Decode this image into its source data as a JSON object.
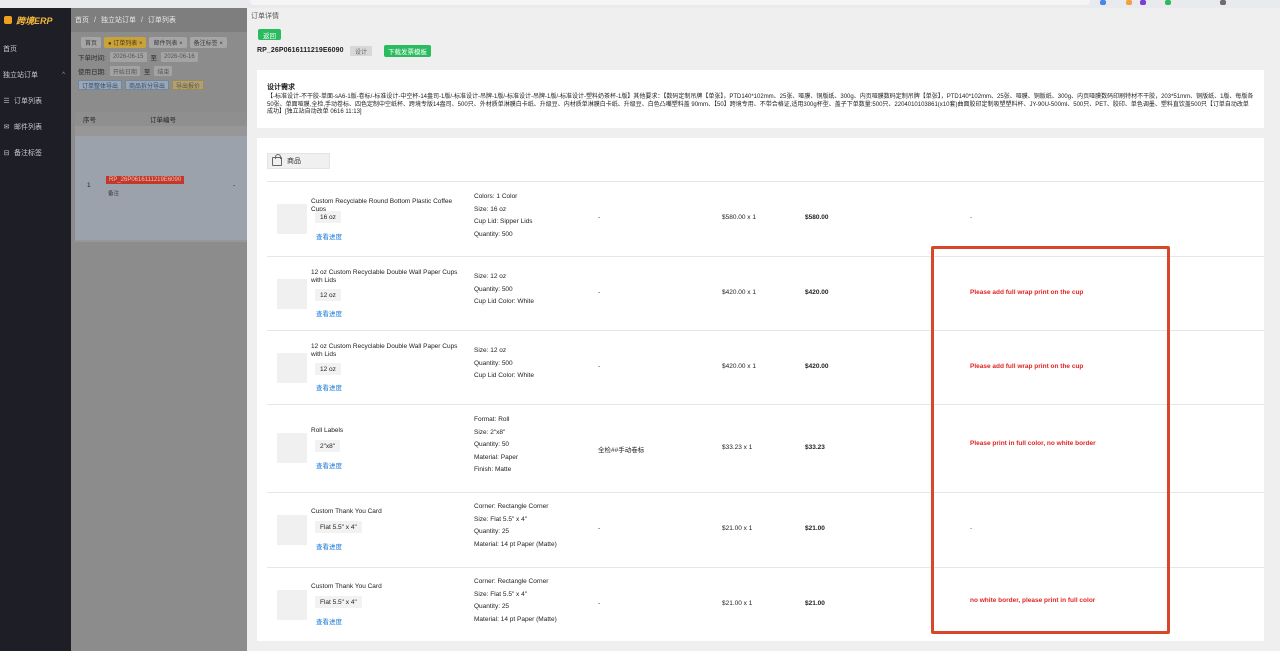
{
  "sidebar": {
    "logo": "跨境ERP",
    "items": [
      {
        "label": "首页",
        "icon": "none"
      },
      {
        "label": "独立站订单",
        "icon": "none",
        "arrow": "^"
      },
      {
        "label": "订单列表",
        "icon": "list-icon"
      },
      {
        "label": "邮件列表",
        "icon": "mail-icon"
      },
      {
        "label": "备注标签",
        "icon": "tag-icon"
      }
    ]
  },
  "underlying_page": {
    "breadcrumb": [
      "首页",
      "独立站订单",
      "订单列表"
    ],
    "breadcrumb_sep": "/",
    "tabs": [
      "首页",
      "● 订单列表 ×",
      "邮件列表 ×",
      "备注标签 ×"
    ],
    "filters": {
      "order_time_label": "下单时间:",
      "order_time_from": "2026-06-15",
      "to": "至",
      "order_time_to": "2026-06-16",
      "use_date_label": "使用日期:",
      "use_date_from": "开始日期",
      "use_date_to": "结束"
    },
    "actions": [
      "订单整体导出",
      "商品拆分导出",
      "导出报价"
    ],
    "table_headers": [
      "序号",
      "订单编号"
    ],
    "row": {
      "index": "1",
      "order_code": "RP_26P0616111219E6090",
      "remark": "备注",
      "dash": "-"
    }
  },
  "drawer": {
    "title": "订单详情",
    "back_label": "返回",
    "order_number": "RP_26P0616111219E6090",
    "design_tag": "设计",
    "download_label": "下载发票模板",
    "design_requirements": {
      "title": "设计需求",
      "text": "【-标准设计-不干胶-单面-sA6-1版-卷标/-标准设计-中空杯-14盎司-1版/-标准设计-吊牌-1版/-标准设计-吊牌-1版/-标准设计-塑料奶茶杯-1版】其他要求：【数码定制吊牌【单张】，PTD140*102mm、25张、哑膜、铜版纸、300g、内页哑膜数码定制吊牌【单张】，PTD140*102mm、25张、哑膜、铜版纸、300g、内页哑膜数码印刷特材不干胶，203*51mm、铜版纸、1版、每版各50张、单面哑膜,全检,手动卷标、四色定制中空纸杯、跨境专版14盎司、500只、外材质单淋膜白卡纸、升级豆、内材质单淋膜白卡纸、升级豆、白色凸嘴塑料盖 90mm、【50】跨境专用、不带合格证,适用300g杯型、盖子下单数量:500只、2204010103861(x10套)曲面胶印定制吸塑塑料杯、JY-90U-500ml、500只、PET、胶印、单色调墨、塑料直饮盖500只【订单自动改单成功】[独立站自动改单 0616 11:13]"
    },
    "goods": {
      "header": "商品",
      "items": [
        {
          "name": "Custom Recyclable Round Bottom Plastic Coffee Cups",
          "spec": "16 oz",
          "link": "查看进度",
          "attrs": [
            "Colors: 1 Color",
            "Size: 16 oz",
            "Cup Lid: Sipper Lids",
            "Quantity: 500"
          ],
          "custom": "-",
          "unit_price": "$580.00 x 1",
          "total": "$580.00",
          "note": "-",
          "note_red": false
        },
        {
          "name": "12 oz Custom Recyclable Double Wall Paper Cups with Lids",
          "spec": "12 oz",
          "link": "查看进度",
          "attrs": [
            "Size: 12 oz",
            "Quantity: 500",
            "Cup Lid Color: White"
          ],
          "custom": "-",
          "unit_price": "$420.00 x 1",
          "total": "$420.00",
          "note": "Please add full wrap print on the cup",
          "note_red": true
        },
        {
          "name": "12 oz Custom Recyclable Double Wall Paper Cups with Lids",
          "spec": "12 oz",
          "link": "查看进度",
          "attrs": [
            "Size: 12 oz",
            "Quantity: 500",
            "Cup Lid Color: White"
          ],
          "custom": "-",
          "unit_price": "$420.00 x 1",
          "total": "$420.00",
          "note": "Please add full wrap print on the cup",
          "note_red": true
        },
        {
          "name": "Roll Labels",
          "spec": "2\"x8\"",
          "link": "查看进度",
          "attrs": [
            "Format: Roll",
            "Size: 2\"x8\"",
            "Quantity: 50",
            "Material: Paper",
            "Finish: Matte"
          ],
          "custom": "全检##手动卷标",
          "unit_price": "$33.23 x 1",
          "total": "$33.23",
          "note": "Please print in full color, no white border",
          "note_red": true
        },
        {
          "name": "Custom Thank You Card",
          "spec": "Flat 5.5\" x 4\"",
          "link": "查看进度",
          "attrs": [
            "Corner: Rectangle Corner",
            "Size: Flat 5.5\" x 4\"",
            "Quantity: 25",
            "Material: 14 pt Paper (Matte)"
          ],
          "custom": "-",
          "unit_price": "$21.00 x 1",
          "total": "$21.00",
          "note": "-",
          "note_red": false
        },
        {
          "name": "Custom Thank You Card",
          "spec": "Flat 5.5\" x 4\"",
          "link": "查看进度",
          "attrs": [
            "Corner: Rectangle Corner",
            "Size: Flat 5.5\" x 4\"",
            "Quantity: 25",
            "Material: 14 pt Paper (Matte)"
          ],
          "custom": "-",
          "unit_price": "$21.00 x 1",
          "total": "$21.00",
          "note": "no white border, please print in full color",
          "note_red": true
        }
      ]
    }
  },
  "colors": {
    "accent_green": "#2bbb5f",
    "link_blue": "#1677d8",
    "note_red": "#e02424",
    "highlight_border": "#d9472b"
  }
}
